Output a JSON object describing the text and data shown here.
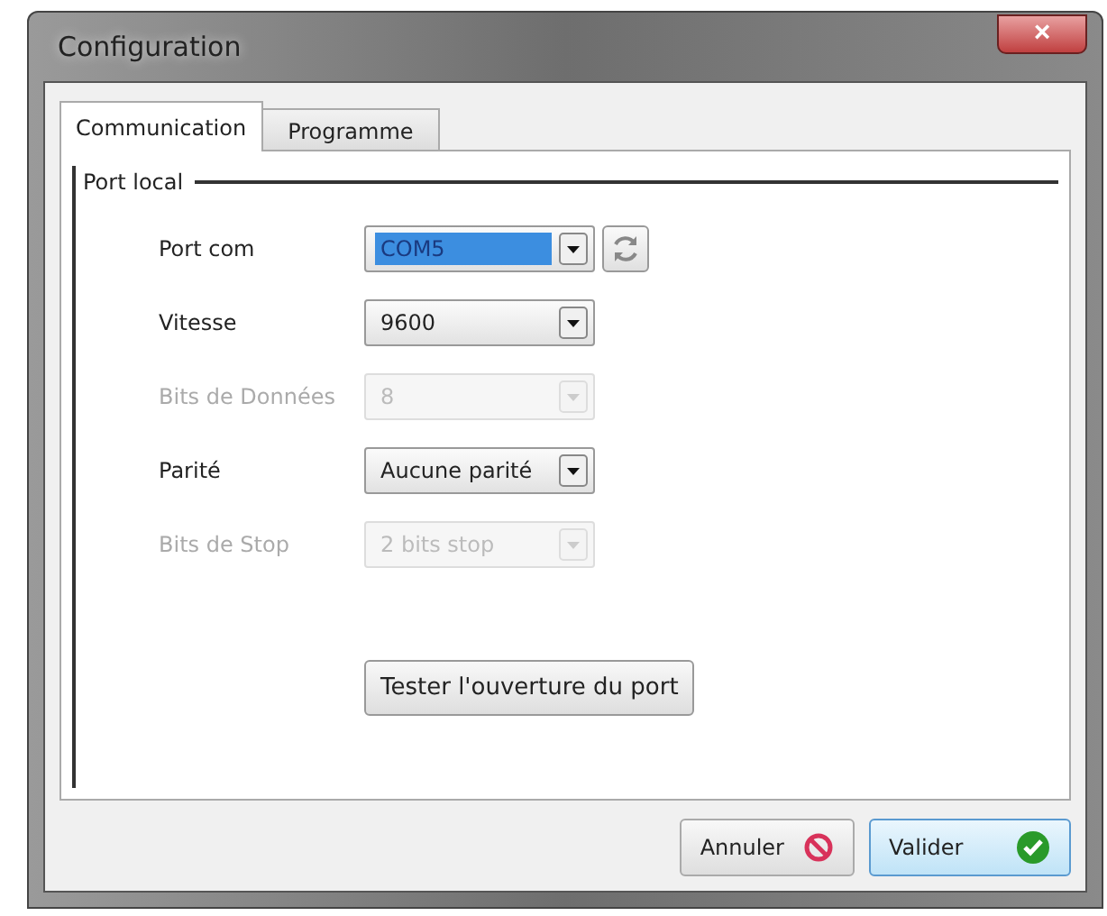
{
  "window": {
    "title": "Configuration",
    "close": "×"
  },
  "tabs": [
    {
      "label": "Communication",
      "selected": true
    },
    {
      "label": "Programme",
      "selected": false
    }
  ],
  "group": {
    "title": "Port local"
  },
  "fields": [
    {
      "label": "Port com",
      "value": "COM5",
      "disabled": false,
      "highlighted": true,
      "refresh_button": true
    },
    {
      "label": "Vitesse",
      "value": "9600",
      "disabled": false,
      "highlighted": false,
      "refresh_button": false
    },
    {
      "label": "Bits de Données",
      "value": "8",
      "disabled": true,
      "highlighted": false,
      "refresh_button": false
    },
    {
      "label": "Parité",
      "value": "Aucune parité",
      "disabled": false,
      "highlighted": false,
      "refresh_button": false
    },
    {
      "label": "Bits de Stop",
      "value": "2 bits stop",
      "disabled": true,
      "highlighted": false,
      "refresh_button": false
    }
  ],
  "test_button": "Tester l'ouverture du port",
  "buttons": [
    {
      "label": "Annuler",
      "kind": "cancel"
    },
    {
      "label": "Valider",
      "kind": "ok"
    }
  ]
}
